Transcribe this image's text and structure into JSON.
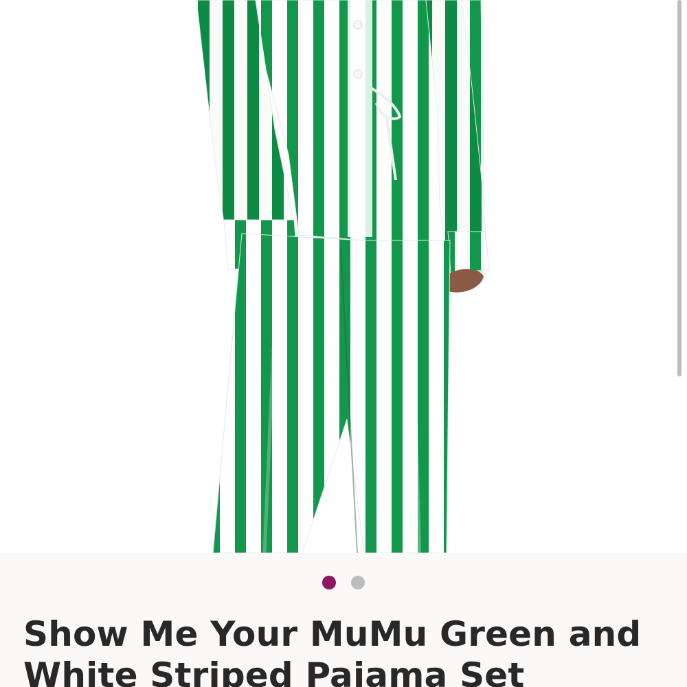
{
  "product": {
    "title": "Show Me Your MuMu Green and White Striped Pajama Set"
  },
  "gallery": {
    "dot_colors": [
      "#8e1464",
      "#bdbdbd"
    ],
    "active_index": 0
  },
  "colors": {
    "stripe_green": "#12984c",
    "stripe_white": "#ffffff",
    "background": "#ffffff",
    "panel_background": "#fbf8f8",
    "title_text": "#282828"
  }
}
